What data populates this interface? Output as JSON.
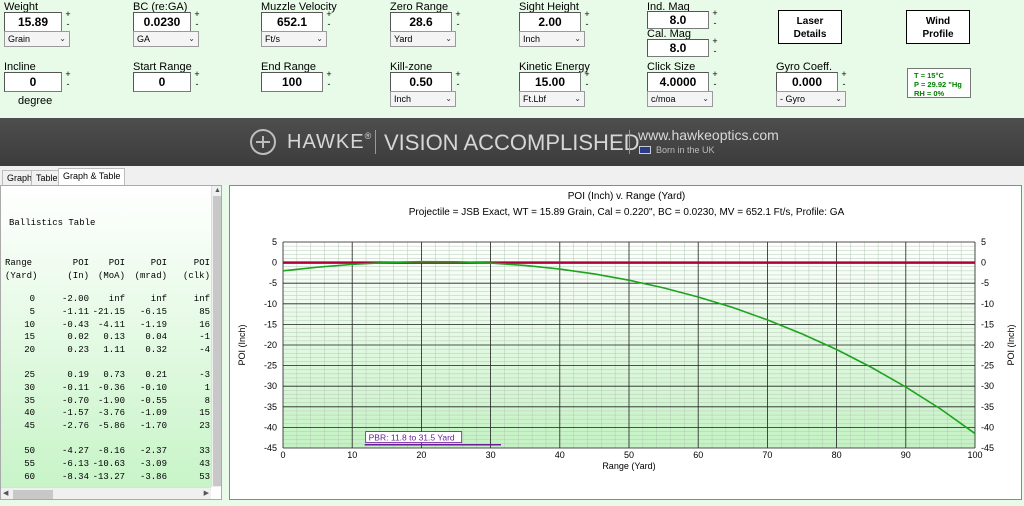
{
  "inputs": {
    "weight": {
      "label": "Weight",
      "value": "15.89",
      "unit": "Grain"
    },
    "bc": {
      "label": "BC (re:GA)",
      "value": "0.0230",
      "unit": "GA"
    },
    "muzzle_velocity": {
      "label": "Muzzle Velocity",
      "value": "652.1",
      "unit": "Ft/s"
    },
    "zero_range": {
      "label": "Zero Range",
      "value": "28.6",
      "unit": "Yard"
    },
    "sight_height": {
      "label": "Sight Height",
      "value": "2.00",
      "unit": "Inch"
    },
    "ind_mag": {
      "label": "Ind. Mag",
      "value": "8.0"
    },
    "cal_mag": {
      "label": "Cal. Mag",
      "value": "8.0"
    },
    "incline": {
      "label": "Incline",
      "value": "0",
      "unit": "degree"
    },
    "start_range": {
      "label": "Start Range",
      "value": "0"
    },
    "end_range": {
      "label": "End Range",
      "value": "100"
    },
    "kill_zone": {
      "label": "Kill-zone",
      "value": "0.50",
      "unit": "Inch"
    },
    "kinetic_energy": {
      "label": "Kinetic Energy",
      "value": "15.00",
      "unit": "Ft.Lbf"
    },
    "click_size": {
      "label": "Click Size",
      "value": "4.0000",
      "unit": "c/moa"
    },
    "gyro_coeff": {
      "label": "Gyro Coeff.",
      "value": "0.000",
      "unit": "- Gyro"
    }
  },
  "spin_plus": "+",
  "spin_minus": "-",
  "dropdown_arrow": "⌄",
  "buttons": {
    "laser": "Laser\nDetails",
    "wind": "Wind\nProfile"
  },
  "atmosphere": {
    "temp": "T = 15°C",
    "pressure": "P = 29.92 \"Hg",
    "humidity": "RH = 0%"
  },
  "banner": {
    "brand": "HAWKE",
    "reg": "®",
    "tagline": "VISION ACCOMPLISHED",
    "url": "www.hawkeoptics.com",
    "born": "Born in the UK"
  },
  "tabs": [
    "Graph",
    "Table",
    "Graph & Table"
  ],
  "table": {
    "title": "Ballistics Table",
    "headers": [
      [
        "Range",
        "(Yard)"
      ],
      [
        "POI",
        "(In)"
      ],
      [
        "POI",
        "(MoA)"
      ],
      [
        "POI",
        "(mrad)"
      ],
      [
        "POI",
        "(clk)"
      ]
    ],
    "rows": [
      [
        "0",
        "-2.00",
        "inf",
        "inf",
        "inf"
      ],
      [
        "5",
        "-1.11",
        "-21.15",
        "-6.15",
        "85"
      ],
      [
        "10",
        "-0.43",
        "-4.11",
        "-1.19",
        "16"
      ],
      [
        "15",
        "0.02",
        "0.13",
        "0.04",
        "-1"
      ],
      [
        "20",
        "0.23",
        "1.11",
        "0.32",
        "-4"
      ],
      [
        "25",
        "0.19",
        "0.73",
        "0.21",
        "-3"
      ],
      [
        "30",
        "-0.11",
        "-0.36",
        "-0.10",
        "1"
      ],
      [
        "35",
        "-0.70",
        "-1.90",
        "-0.55",
        "8"
      ],
      [
        "40",
        "-1.57",
        "-3.76",
        "-1.09",
        "15"
      ],
      [
        "45",
        "-2.76",
        "-5.86",
        "-1.70",
        "23"
      ],
      [
        "50",
        "-4.27",
        "-8.16",
        "-2.37",
        "33"
      ],
      [
        "55",
        "-6.13",
        "-10.63",
        "-3.09",
        "43"
      ],
      [
        "60",
        "-8.34",
        "-13.27",
        "-3.86",
        "53"
      ]
    ]
  },
  "chart_data": {
    "type": "line",
    "title": "POI (Inch) v. Range (Yard)",
    "subtitle": "Projectile = JSB Exact, WT = 15.89 Grain, Cal = 0.220\", BC = 0.0230, MV = 652.1 Ft/s, Profile: GA",
    "xlabel": "Range (Yard)",
    "ylabel": "POI (Inch)",
    "xlim": [
      0,
      100
    ],
    "ylim": [
      -45,
      5
    ],
    "xticks": [
      0,
      10,
      20,
      30,
      40,
      50,
      60,
      70,
      80,
      90,
      100
    ],
    "yticks": [
      5,
      0,
      -5,
      -10,
      -15,
      -20,
      -25,
      -30,
      -35,
      -40,
      -45
    ],
    "grid": true,
    "series": [
      {
        "color": "#1ea31e",
        "x": [
          0,
          5,
          10,
          15,
          20,
          25,
          30,
          35,
          40,
          45,
          50,
          55,
          60,
          65,
          70,
          75,
          80,
          85,
          90,
          95,
          100
        ],
        "y": [
          -2.0,
          -1.11,
          -0.43,
          0.02,
          0.23,
          0.19,
          -0.11,
          -0.7,
          -1.57,
          -2.76,
          -4.27,
          -6.13,
          -8.34,
          -10.9,
          -13.9,
          -17.3,
          -21.1,
          -25.4,
          -30.2,
          -35.5,
          -41.5
        ]
      }
    ],
    "reference_line": {
      "y": 0,
      "color": "#b0003a"
    },
    "pbr": {
      "label": "PBR: 11.8 to 31.5 Yard",
      "x_start": 11.8,
      "x_end": 31.5,
      "color": "#6a1b9a"
    }
  }
}
